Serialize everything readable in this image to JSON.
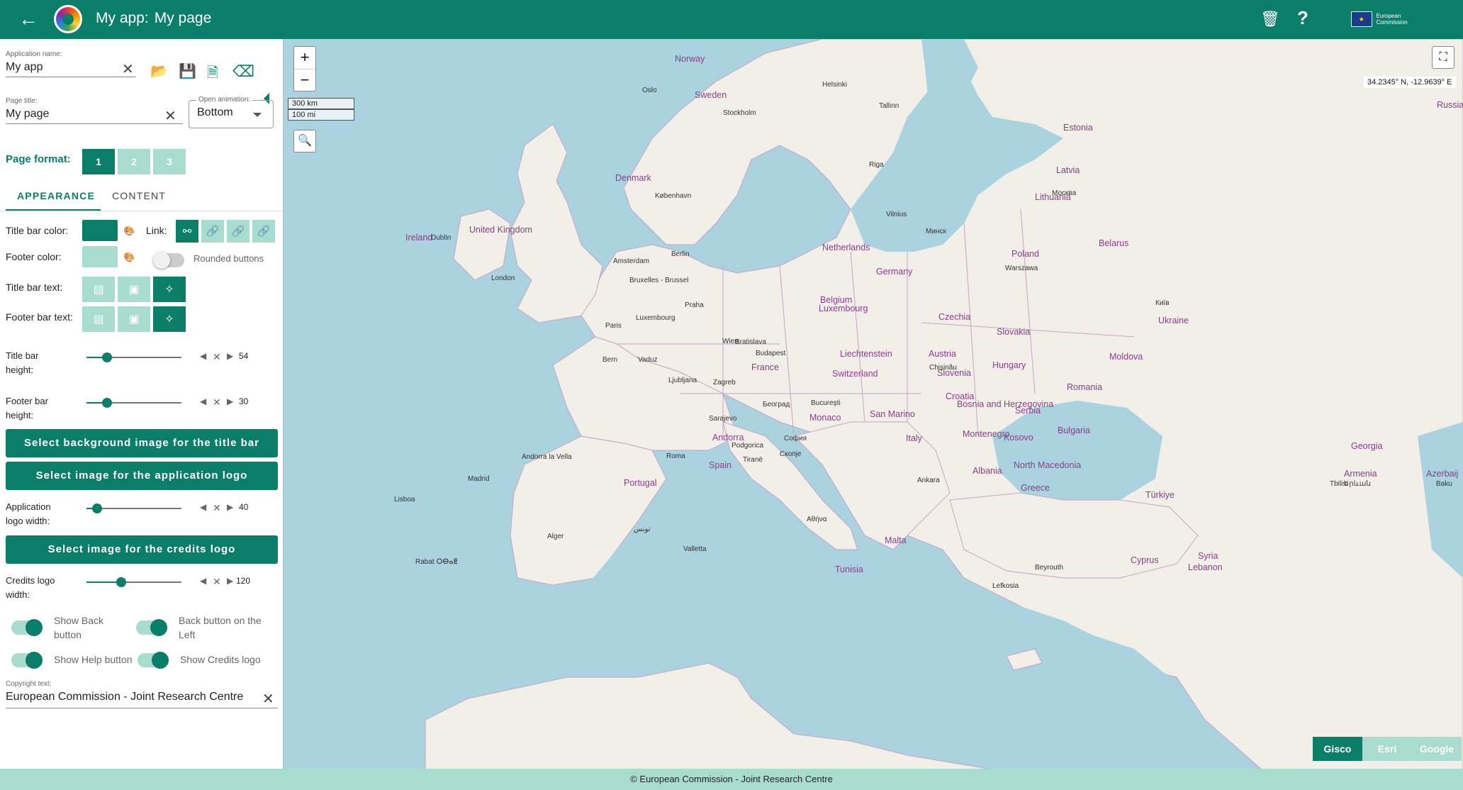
{
  "titlebar": {
    "app_prefix": "My app:",
    "page_title": "My page",
    "back_icon": "arrow-left",
    "trash_icon": "trash",
    "help_icon": "?",
    "credits_logo_text": "European Commission",
    "color": "#0b7e6a"
  },
  "panel": {
    "app_name": {
      "label": "Application name:",
      "value": "My app"
    },
    "page_title": {
      "label": "Page title:",
      "value": "My page"
    },
    "open_animation": {
      "label": "Open animation:",
      "value": "Bottom"
    },
    "page_format": {
      "label": "Page format:",
      "options": [
        "1",
        "2",
        "3"
      ],
      "selected": "1"
    },
    "tabs": {
      "appearance": "APPEARANCE",
      "content": "CONTENT",
      "active": "APPEARANCE"
    },
    "title_bar_color_label": "Title bar color:",
    "footer_color_label": "Footer color:",
    "title_bar_color": "#0b7e6a",
    "footer_color": "#a7dccf",
    "link_label": "Link:",
    "rounded_buttons_label": "Rounded buttons",
    "rounded_buttons": false,
    "title_bar_text_label": "Title bar text:",
    "footer_bar_text_label": "Footer bar text:",
    "title_bar_height": {
      "label1": "Title bar",
      "label2": "height:",
      "value": "54"
    },
    "footer_bar_height": {
      "label1": "Footer bar",
      "label2": "height:",
      "value": "30"
    },
    "btn_title_bg": "Select background image for the title bar",
    "btn_app_logo": "Select image for the application logo",
    "app_logo_width": {
      "label1": "Application",
      "label2": "logo width:",
      "value": "40"
    },
    "btn_credits_logo": "Select image for the credits logo",
    "credits_logo_width": {
      "label1": "Credits logo",
      "label2": "width:",
      "value": "120"
    },
    "show_back": {
      "label1": "Show Back",
      "label2": "button",
      "value": true
    },
    "back_left": {
      "label1": "Back button on the",
      "label2": "Left",
      "value": true
    },
    "show_help": {
      "label": "Show Help button",
      "value": true
    },
    "show_credits": {
      "label": "Show Credits logo",
      "value": true
    },
    "copyright": {
      "label": "Copyright text:",
      "value": "European Commission - Joint Research Centre"
    }
  },
  "map": {
    "zoom_in": "+",
    "zoom_out": "−",
    "scale_km": "300 km",
    "scale_mi": "100 mi",
    "coords": "34.2345° N, -12.9639° E",
    "basemaps": [
      "Gisco",
      "Esri",
      "Google"
    ],
    "active_basemap": "Gisco",
    "countries": [
      "Norway",
      "Sweden",
      "Russia",
      "Estonia",
      "Latvia",
      "Lithuania",
      "Belarus",
      "Poland",
      "Ukraine",
      "Germany",
      "Netherlands",
      "Belgium",
      "Luxembourg",
      "Czechia",
      "Slovakia",
      "Austria",
      "Hungary",
      "Moldova",
      "Romania",
      "Liechtenstein",
      "Switzerland",
      "France",
      "Slovenia",
      "Croatia",
      "Bosnia and Herzegovina",
      "Serbia",
      "Montenegro",
      "Kosovo",
      "Bulgaria",
      "Italy",
      "San Marino",
      "Monaco",
      "Andorra",
      "Spain",
      "Portugal",
      "Albania",
      "North Macedonia",
      "Greece",
      "Türkiye",
      "Georgia",
      "Armenia",
      "Azerbaij",
      "Malta",
      "Tunisia",
      "Syria",
      "Lebanon",
      "Cyprus",
      "Ireland",
      "United Kingdom",
      "Denmark"
    ],
    "cities": [
      "Oslo",
      "Stockholm",
      "Helsinki",
      "Tallinn",
      "Riga",
      "Vilnius",
      "Минск",
      "Москва",
      "København",
      "Berlin",
      "Warszawa",
      "Київ",
      "Amsterdam",
      "London",
      "Dublin",
      "Bruxelles - Brussel",
      "Luxembourg",
      "Praha",
      "Paris",
      "Wien",
      "Bratislava",
      "Budapest",
      "Chişinău",
      "Bern",
      "Vaduz",
      "Ljubljana",
      "Zagreb",
      "Bucureşti",
      "Београд",
      "Sarajevo",
      "Podgorica",
      "София",
      "Скопје",
      "Tiranë",
      "Roma",
      "Andorra la Vella",
      "Madrid",
      "Lisboa",
      "Αθήνα",
      "Ankara",
      "Alger",
      "Valletta",
      "Rabat ⵔⴱⴰⵟ",
      "تونس",
      "Lefkosia",
      "Beyrouth",
      "Tbilisi",
      "Երևան",
      "Baku"
    ]
  },
  "footer": {
    "text": "European Commission - Joint Research Centre",
    "copyright_symbol": "©"
  }
}
